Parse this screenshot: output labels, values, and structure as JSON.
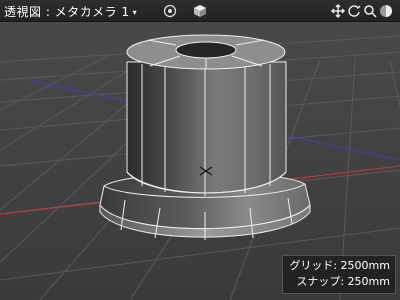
{
  "viewport": {
    "title": "透視図 : メタカメラ 1",
    "title_caret": "▾",
    "icons": [
      "target-icon",
      "cube-icon",
      "move-arrows-icon",
      "rotate-icon",
      "zoom-icon",
      "display-mode-icon"
    ]
  },
  "info": {
    "grid_label": "グリッド: 2500mm",
    "snap_label": "スナップ: 250mm"
  },
  "colors": {
    "x_axis": "#c83a3a",
    "z_axis": "#4040b8",
    "grid_line": "#5a5a5a",
    "background": "#3f3f3f",
    "edge": "#f0f0f0"
  }
}
